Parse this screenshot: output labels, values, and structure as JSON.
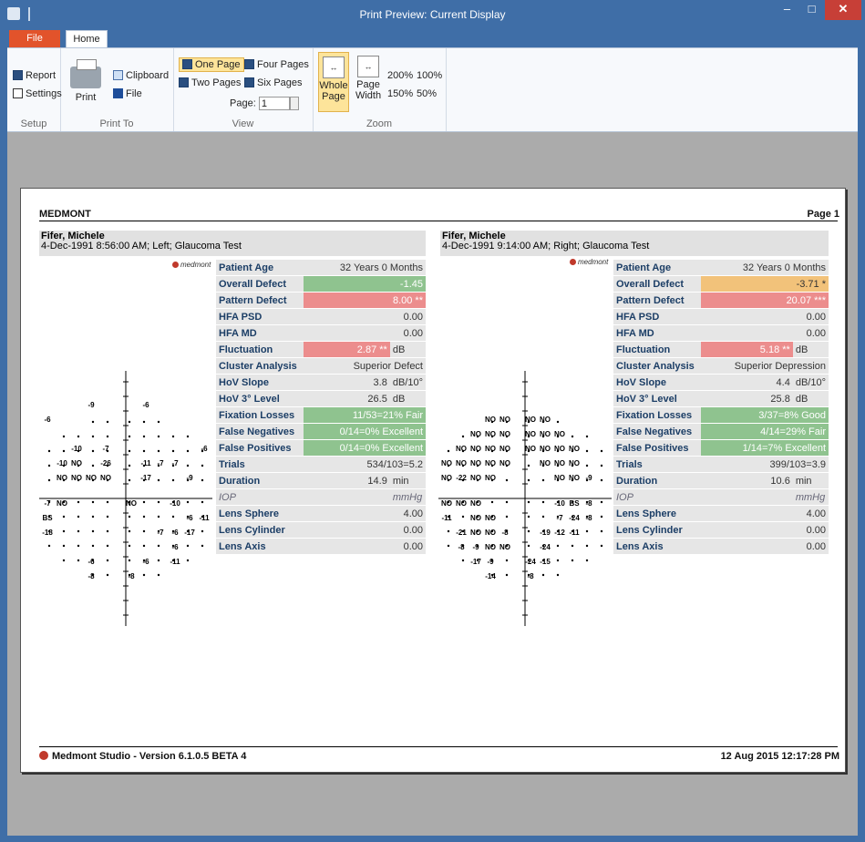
{
  "window": {
    "title": "Print Preview: Current Display",
    "minimize": "–",
    "maximize": "□",
    "close": "✕"
  },
  "ribbon": {
    "tabs": {
      "file": "File",
      "home": "Home"
    },
    "setup": {
      "report": "Report",
      "settings": "Settings",
      "label": "Setup"
    },
    "print_to": {
      "print": "Print",
      "clipboard": "Clipboard",
      "file": "File",
      "label": "Print To"
    },
    "view": {
      "one_page": "One Page",
      "four_pages": "Four Pages",
      "two_pages": "Two Pages",
      "six_pages": "Six Pages",
      "page_label": "Page:",
      "page_value": "1",
      "label": "View"
    },
    "zoom": {
      "whole_page": "Whole Page",
      "page_width": "Page Width",
      "z200": "200%",
      "z100": "100%",
      "z150": "150%",
      "z50": "50%",
      "label": "Zoom"
    }
  },
  "report": {
    "brand": "MEDMONT",
    "page": "Page 1",
    "logo_text": "medmont",
    "footer_left": "Medmont Studio - Version 6.1.0.5 BETA 4",
    "footer_right": "12 Aug 2015 12:17:28 PM",
    "left": {
      "name": "Fifer, Michele",
      "subtitle": "4-Dec-1991 8:56:00 AM; Left; Glaucoma Test",
      "rows": [
        {
          "label": "Patient Age",
          "value": "32 Years 0 Months",
          "unit": "",
          "status": ""
        },
        {
          "label": "Overall Defect",
          "value": "-1.45",
          "unit": "",
          "status": "green"
        },
        {
          "label": "Pattern Defect",
          "value": "8.00 **",
          "unit": "",
          "status": "red"
        },
        {
          "label": "HFA PSD",
          "value": "0.00",
          "unit": "",
          "status": ""
        },
        {
          "label": "HFA MD",
          "value": "0.00",
          "unit": "",
          "status": ""
        },
        {
          "label": "Fluctuation",
          "value": "2.87 **",
          "unit": "dB",
          "status": "red"
        },
        {
          "label": "Cluster Analysis",
          "value": "Superior Defect",
          "unit": "",
          "status": ""
        },
        {
          "label": "HoV Slope",
          "value": "3.8",
          "unit": "dB/10°",
          "status": ""
        },
        {
          "label": "HoV 3° Level",
          "value": "26.5",
          "unit": "dB",
          "status": ""
        },
        {
          "label": "Fixation Losses",
          "value": "11/53=21% Fair",
          "unit": "",
          "status": "green"
        },
        {
          "label": "False Negatives",
          "value": "0/14=0% Excellent",
          "unit": "",
          "status": "green"
        },
        {
          "label": "False Positives",
          "value": "0/14=0% Excellent",
          "unit": "",
          "status": "green"
        },
        {
          "label": "Trials",
          "value": "534/103=5.2",
          "unit": "",
          "status": ""
        },
        {
          "label": "Duration",
          "value": "14.9",
          "unit": "min",
          "status": ""
        },
        {
          "label": "IOP",
          "value": "",
          "unit": "mmHg",
          "status": "italic"
        },
        {
          "label": "Lens Sphere",
          "value": "4.00",
          "unit": "",
          "status": ""
        },
        {
          "label": "Lens Cylinder",
          "value": "0.00",
          "unit": "",
          "status": ""
        },
        {
          "label": "Lens Axis",
          "value": "0.00",
          "unit": "",
          "status": ""
        }
      ],
      "points": [
        [
          "-9",
          -2,
          6
        ],
        [
          "-6",
          1,
          6
        ],
        [
          "-6",
          -5,
          5
        ],
        [
          "-10",
          -3,
          3
        ],
        [
          "-7",
          -1,
          3
        ],
        [
          "-6",
          5,
          3
        ],
        [
          "-10",
          -4,
          2
        ],
        [
          "-26",
          -1,
          2
        ],
        [
          "-7",
          2,
          2
        ],
        [
          "-7",
          3,
          2
        ],
        [
          "NO",
          -3,
          2
        ],
        [
          "-11",
          1,
          2
        ],
        [
          "-9",
          4,
          1
        ],
        [
          "NO",
          -4,
          1
        ],
        [
          "NO",
          -3,
          1
        ],
        [
          "NO",
          -2,
          1
        ],
        [
          "NO",
          -1,
          1
        ],
        [
          "-17",
          1,
          1
        ],
        [
          "-7",
          -5,
          0
        ],
        [
          "NO",
          -4,
          0
        ],
        [
          "NO",
          0,
          0
        ],
        [
          "-10",
          3,
          0
        ],
        [
          "BS",
          -5,
          -1
        ],
        [
          "-6",
          4,
          -1
        ],
        [
          "-11",
          5,
          -1
        ],
        [
          "-18",
          -5,
          -2
        ],
        [
          "-6",
          3,
          -2
        ],
        [
          "-7",
          2,
          -2
        ],
        [
          "-17",
          4,
          -2
        ],
        [
          "-6",
          3,
          -3
        ],
        [
          "-6",
          -2,
          -4
        ],
        [
          "-6",
          1,
          -4
        ],
        [
          "-11",
          3,
          -4
        ],
        [
          "-8",
          -2,
          -5
        ],
        [
          "-8",
          0,
          -5
        ]
      ]
    },
    "right": {
      "name": "Fifer, Michele",
      "subtitle": "4-Dec-1991 9:14:00 AM; Right; Glaucoma Test",
      "rows": [
        {
          "label": "Patient Age",
          "value": "32 Years 0 Months",
          "unit": "",
          "status": ""
        },
        {
          "label": "Overall Defect",
          "value": "-3.71 *",
          "unit": "",
          "status": "orange"
        },
        {
          "label": "Pattern Defect",
          "value": "20.07 ***",
          "unit": "",
          "status": "red"
        },
        {
          "label": "HFA PSD",
          "value": "0.00",
          "unit": "",
          "status": ""
        },
        {
          "label": "HFA MD",
          "value": "0.00",
          "unit": "",
          "status": ""
        },
        {
          "label": "Fluctuation",
          "value": "5.18 **",
          "unit": "dB",
          "status": "red"
        },
        {
          "label": "Cluster Analysis",
          "value": "Superior Depression",
          "unit": "",
          "status": ""
        },
        {
          "label": "HoV Slope",
          "value": "4.4",
          "unit": "dB/10°",
          "status": ""
        },
        {
          "label": "HoV 3° Level",
          "value": "25.8",
          "unit": "dB",
          "status": ""
        },
        {
          "label": "Fixation Losses",
          "value": "3/37=8% Good",
          "unit": "",
          "status": "green"
        },
        {
          "label": "False Negatives",
          "value": "4/14=29% Fair",
          "unit": "",
          "status": "green"
        },
        {
          "label": "False Positives",
          "value": "1/14=7% Excellent",
          "unit": "",
          "status": "green"
        },
        {
          "label": "Trials",
          "value": "399/103=3.9",
          "unit": "",
          "status": ""
        },
        {
          "label": "Duration",
          "value": "10.6",
          "unit": "min",
          "status": ""
        },
        {
          "label": "IOP",
          "value": "",
          "unit": "mmHg",
          "status": "italic"
        },
        {
          "label": "Lens Sphere",
          "value": "4.00",
          "unit": "",
          "status": ""
        },
        {
          "label": "Lens Cylinder",
          "value": "0.00",
          "unit": "",
          "status": ""
        },
        {
          "label": "Lens Axis",
          "value": "0.00",
          "unit": "",
          "status": ""
        }
      ],
      "points": [
        [
          "NO",
          -2,
          5
        ],
        [
          "NO",
          -1,
          5
        ],
        [
          "NO",
          0,
          5
        ],
        [
          "NO",
          1,
          5
        ],
        [
          "NO",
          -3,
          4
        ],
        [
          "NO",
          -2,
          4
        ],
        [
          "NO",
          -1,
          4
        ],
        [
          "NO",
          0,
          4
        ],
        [
          "NO",
          1,
          4
        ],
        [
          "NO",
          2,
          4
        ],
        [
          "NO",
          -4,
          3
        ],
        [
          "NO",
          -3,
          3
        ],
        [
          "NO",
          -2,
          3
        ],
        [
          "NO",
          -1,
          3
        ],
        [
          "NO",
          0,
          3
        ],
        [
          "NO",
          1,
          3
        ],
        [
          "NO",
          2,
          3
        ],
        [
          "NO",
          3,
          3
        ],
        [
          "NO",
          -5,
          2
        ],
        [
          "NO",
          -4,
          2
        ],
        [
          "NO",
          -3,
          2
        ],
        [
          "NO",
          -2,
          2
        ],
        [
          "NO",
          -1,
          2
        ],
        [
          "NO",
          1,
          2
        ],
        [
          "NO",
          2,
          2
        ],
        [
          "NO",
          3,
          2
        ],
        [
          "-9",
          4,
          1
        ],
        [
          "NO",
          -5,
          1
        ],
        [
          "-22",
          -4,
          1
        ],
        [
          "NO",
          -3,
          1
        ],
        [
          "NO",
          -2,
          1
        ],
        [
          "NO",
          2,
          1
        ],
        [
          "NO",
          3,
          1
        ],
        [
          "NO",
          -5,
          0
        ],
        [
          "NO",
          -4,
          0
        ],
        [
          "NO",
          -3,
          0
        ],
        [
          "-10",
          2,
          0
        ],
        [
          "BS",
          3,
          0
        ],
        [
          "-8",
          4,
          0
        ],
        [
          "-11",
          -5,
          -1
        ],
        [
          "NO",
          -3,
          -1
        ],
        [
          "NO",
          -2,
          -1
        ],
        [
          "-7",
          2,
          -1
        ],
        [
          "-24",
          3,
          -1
        ],
        [
          "-8",
          4,
          -1
        ],
        [
          "-21",
          -4,
          -2
        ],
        [
          "NO",
          -3,
          -2
        ],
        [
          "NO",
          -2,
          -2
        ],
        [
          "-8",
          -1,
          -2
        ],
        [
          "-19",
          1,
          -2
        ],
        [
          "-12",
          2,
          -2
        ],
        [
          "-11",
          3,
          -2
        ],
        [
          "-8",
          -4,
          -3
        ],
        [
          "-9",
          -3,
          -3
        ],
        [
          "NO",
          -2,
          -3
        ],
        [
          "NO",
          -1,
          -3
        ],
        [
          "-24",
          1,
          -3
        ],
        [
          "-17",
          -3,
          -4
        ],
        [
          "-9",
          -2,
          -4
        ],
        [
          "-24",
          0,
          -4
        ],
        [
          "-15",
          1,
          -4
        ],
        [
          "-14",
          -2,
          -5
        ],
        [
          "-8",
          0,
          -5
        ]
      ]
    }
  }
}
